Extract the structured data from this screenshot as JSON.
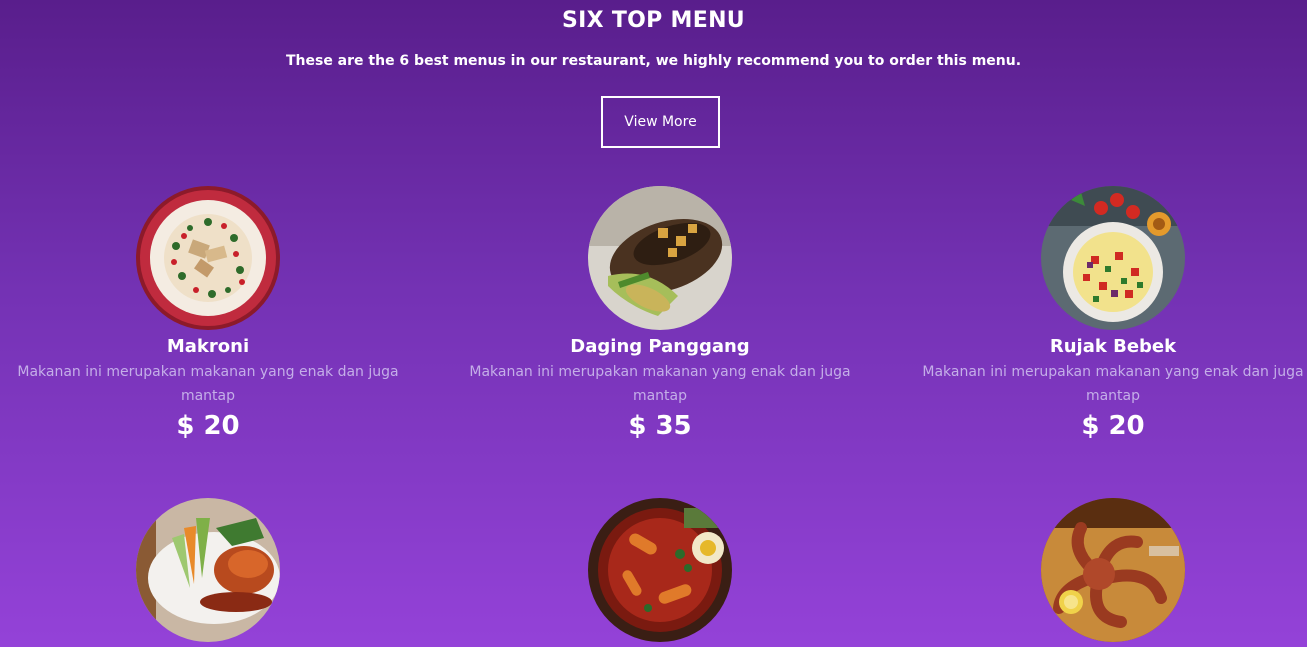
{
  "section": {
    "title": "SIX TOP MENU",
    "subtitle": "These are the 6 best menus in our restaurant, we highly recommend you to order this menu.",
    "view_more_label": "View More"
  },
  "menu": [
    {
      "name": "Makroni",
      "description": "Makanan ini merupakan makanan yang enak dan juga mantap",
      "price": "$ 20",
      "image": "macaroni-plate-photo"
    },
    {
      "name": "Daging Panggang",
      "description": "Makanan ini merupakan makanan yang enak dan juga mantap",
      "price": "$ 35",
      "image": "grilled-meat-photo"
    },
    {
      "name": "Rujak Bebek",
      "description": "Makanan ini merupakan makanan yang enak dan juga mantap",
      "price": "$ 20",
      "image": "salad-bowl-photo"
    },
    {
      "image": "fried-chicken-salad-photo"
    },
    {
      "image": "spicy-stew-photo"
    },
    {
      "image": "grilled-octopus-photo"
    }
  ],
  "colors": {
    "background_top": "#591e8c",
    "background_bottom": "#9442d8",
    "description_text": "#c4aee8"
  }
}
